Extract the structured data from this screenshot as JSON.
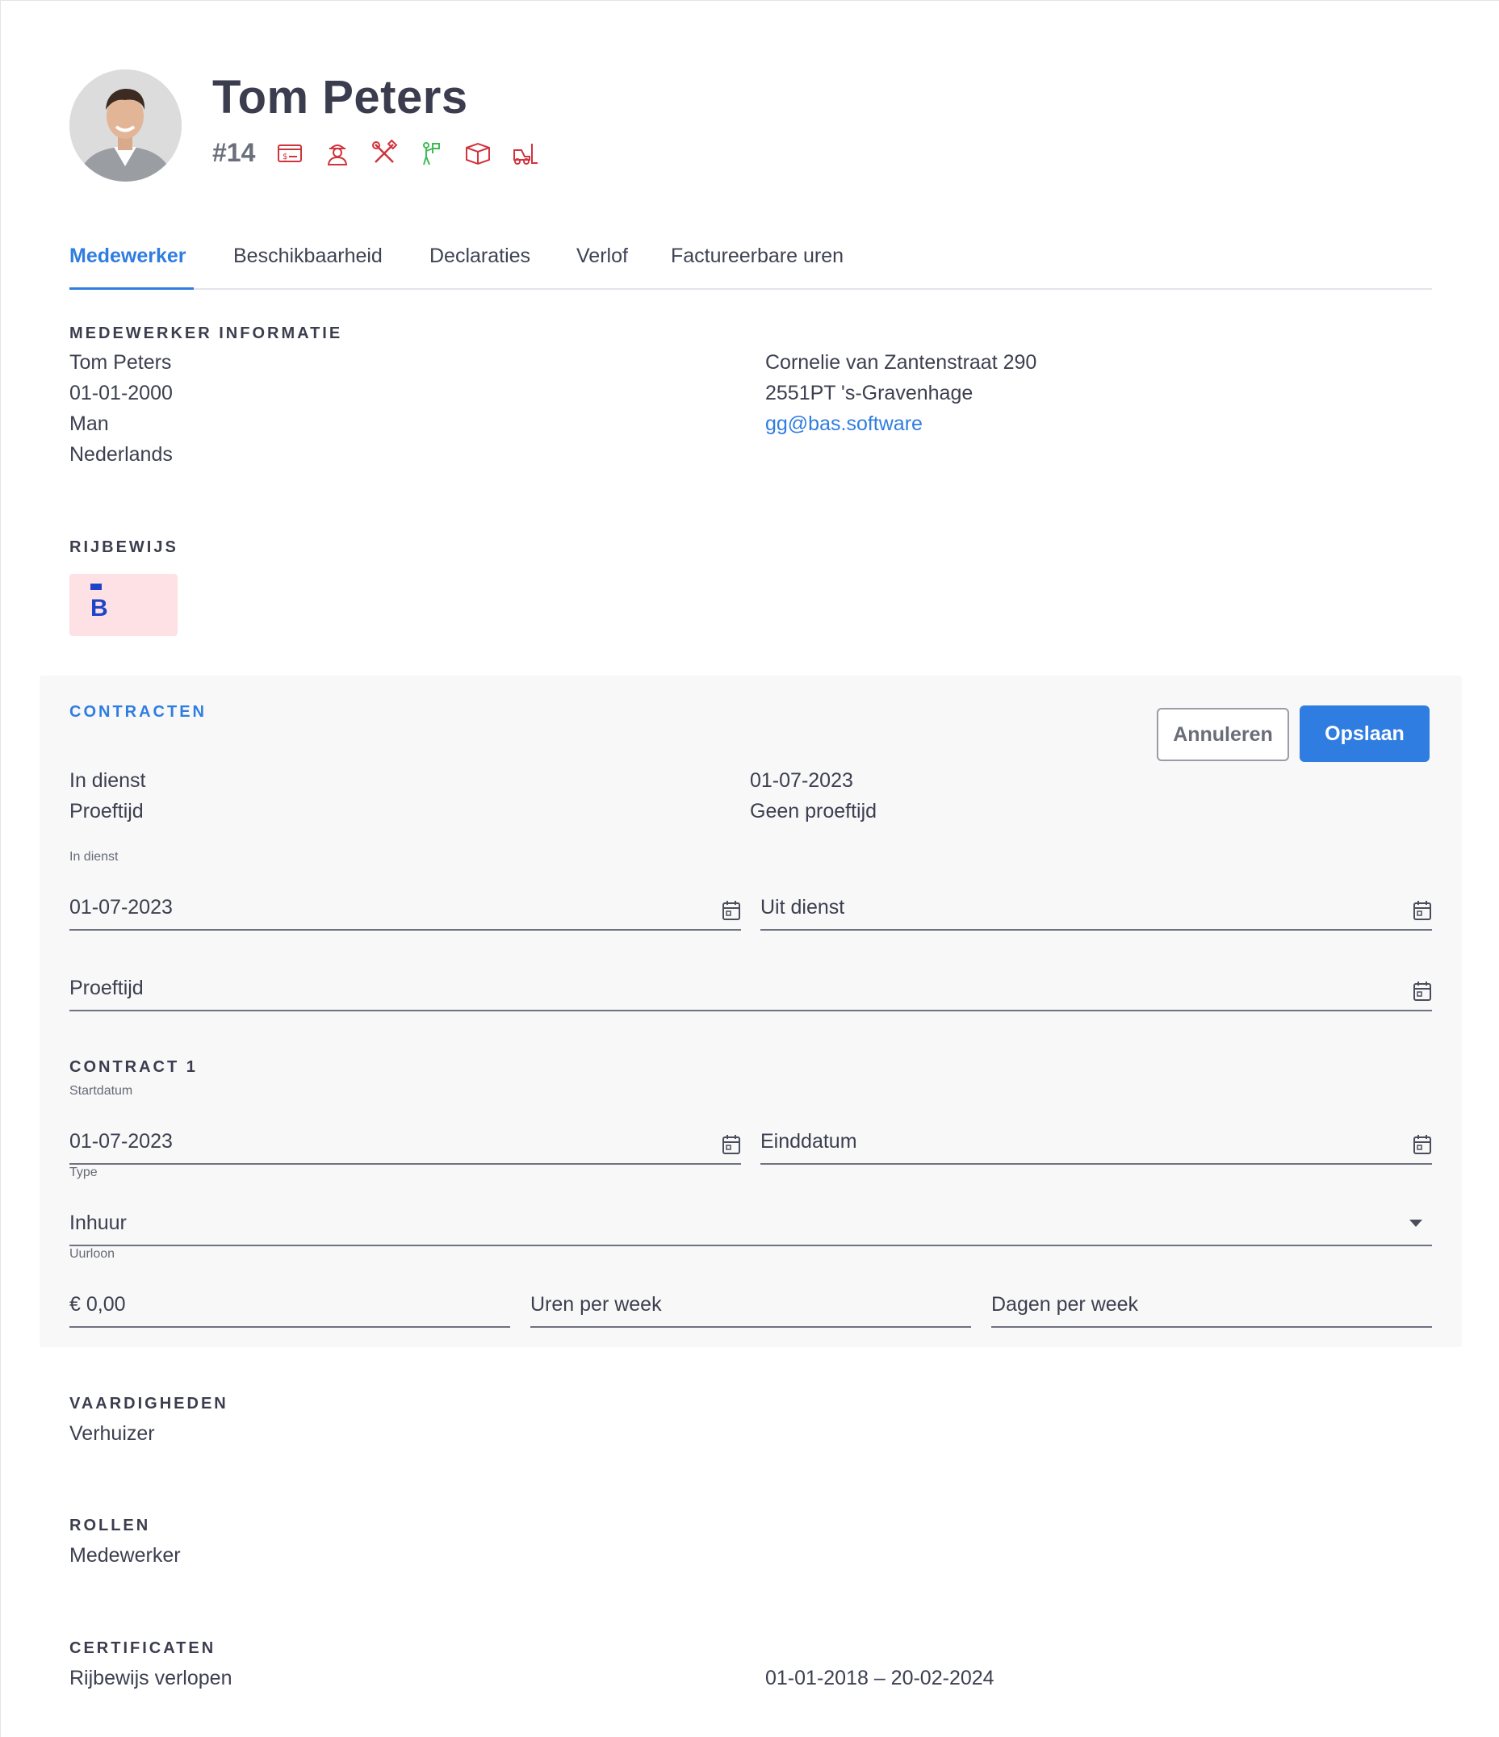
{
  "profile": {
    "name": "Tom Peters",
    "employee_id": "#14",
    "icons": [
      "payment-card-icon",
      "worker-icon",
      "tools-icon",
      "flag-person-icon",
      "box-icon",
      "forklift-icon"
    ]
  },
  "tabs": [
    {
      "label": "Medewerker",
      "active": true
    },
    {
      "label": "Beschikbaarheid",
      "active": false
    },
    {
      "label": "Declaraties",
      "active": false
    },
    {
      "label": "Verlof",
      "active": false
    },
    {
      "label": "Factureerbare uren",
      "active": false
    }
  ],
  "employee_info": {
    "heading": "MEDEWERKER INFORMATIE",
    "name": "Tom Peters",
    "birthdate": "01-01-2000",
    "gender": "Man",
    "nationality": "Nederlands",
    "street": "Cornelie van Zantenstraat 290",
    "city": "2551PT 's-Gravenhage",
    "email": "gg@bas.software"
  },
  "license": {
    "heading": "RIJBEWIJS",
    "category": "B"
  },
  "contracts": {
    "heading": "CONTRACTEN",
    "cancel_label": "Annuleren",
    "save_label": "Opslaan",
    "summary": [
      {
        "label": "In dienst",
        "value": "01-07-2023"
      },
      {
        "label": "Proeftijd",
        "value": "Geen proeftijd"
      }
    ],
    "in_service": {
      "label": "In dienst",
      "value": "01-07-2023"
    },
    "out_service": {
      "placeholder": "Uit dienst"
    },
    "probation": {
      "placeholder": "Proeftijd"
    },
    "contract1": {
      "heading": "CONTRACT 1",
      "start": {
        "label": "Startdatum",
        "value": "01-07-2023"
      },
      "end": {
        "placeholder": "Einddatum"
      },
      "type": {
        "label": "Type",
        "value": "Inhuur"
      },
      "wage": {
        "label": "Uurloon",
        "value": "€ 0,00"
      },
      "hours": {
        "placeholder": "Uren per week"
      },
      "days": {
        "placeholder": "Dagen per week"
      }
    }
  },
  "skills": {
    "heading": "VAARDIGHEDEN",
    "value": "Verhuizer"
  },
  "roles": {
    "heading": "ROLLEN",
    "value": "Medewerker"
  },
  "certificates": {
    "heading": "CERTIFICATEN",
    "name": "Rijbewijs verlopen",
    "period": "01-01-2018 – 20-02-2024"
  },
  "colors": {
    "accent": "#2f7de1",
    "icon_red": "#d0343c",
    "icon_green": "#3fba55",
    "license_bg": "#fde1e4",
    "license_fg": "#1e44c8"
  }
}
